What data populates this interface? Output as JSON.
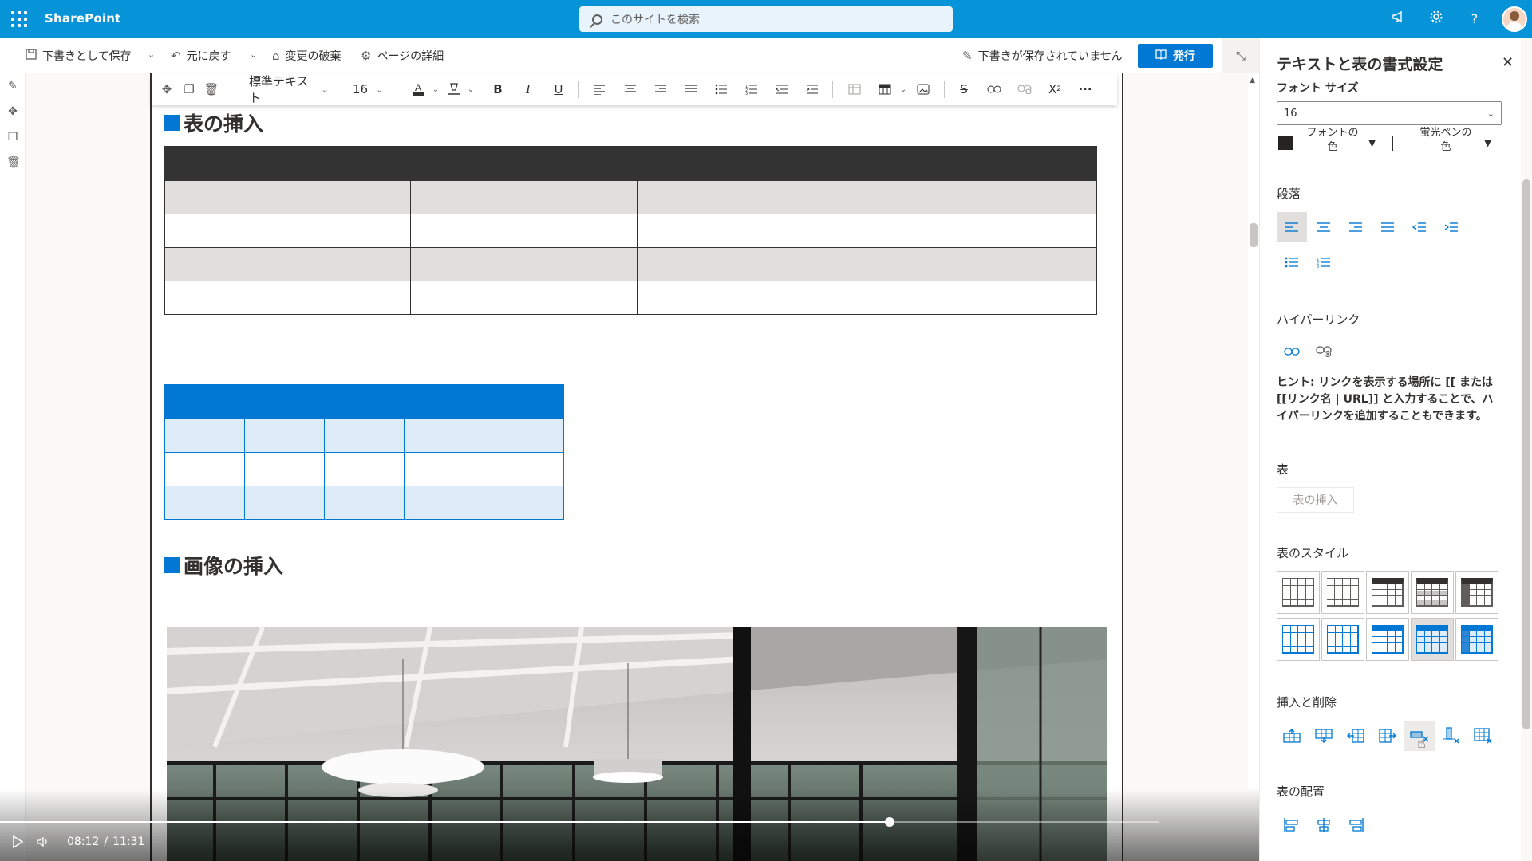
{
  "topbar": {
    "brand": "SharePoint",
    "search_placeholder": "このサイトを検索"
  },
  "commandbar": {
    "save_draft": "下書きとして保存",
    "undo": "元に戻す",
    "discard": "変更の破棄",
    "page_details": "ページの詳細",
    "draft_status": "下書きが保存されていません",
    "publish": "発行"
  },
  "rte_toolbar": {
    "style": "標準テキスト",
    "size": "16"
  },
  "content": {
    "heading_table": "表の挿入",
    "heading_image": "画像の挿入"
  },
  "video": {
    "current": "08:12",
    "separator": "/",
    "total": "11:31",
    "progress_fraction": 0.768
  },
  "pane": {
    "title": "テキストと表の書式設定",
    "font_size_label": "フォント サイズ",
    "font_size_value": "16",
    "font_color_line1": "フォントの",
    "font_color_line2": "色",
    "highlight_line1": "蛍光ペンの",
    "highlight_line2": "色",
    "paragraph": "段落",
    "hyperlink": "ハイパーリンク",
    "hint": "ヒント: リンクを表示する場所に [[ または [[リンク名 | URL]] と入力することで、ハイパーリンクを追加することもできます。",
    "table": "表",
    "insert_table": "表の挿入",
    "table_style": "表のスタイル",
    "insert_delete": "挿入と削除",
    "table_align": "表の配置"
  },
  "colors": {
    "topbar": "#0693d8",
    "accent": "#0078d4",
    "dark_header": "#333333",
    "alt_row": "#e1dfdd",
    "light_blue": "#deecf9"
  }
}
